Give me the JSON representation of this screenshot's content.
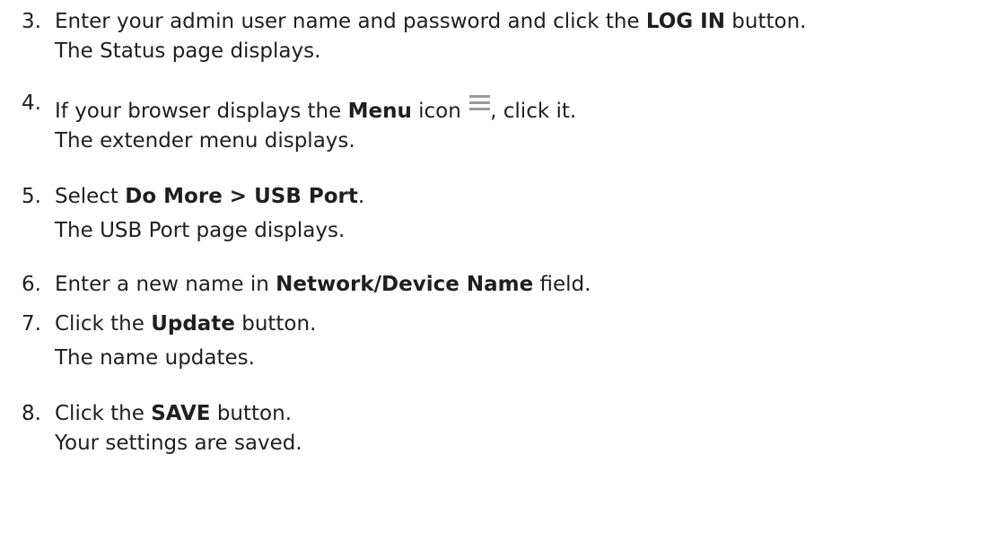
{
  "steps": [
    {
      "number": "3.",
      "lead": "Enter your admin user name and password and click the ",
      "bold": "LOG IN",
      "tail": " button.",
      "result": "The Status page displays."
    },
    {
      "number": "4.",
      "lead": "If your browser displays the ",
      "bold": "Menu",
      "tail_before_icon": " icon ",
      "icon": "hamburger-menu-icon",
      "tail_after_icon": ", click it.",
      "result": "The extender menu displays."
    },
    {
      "number": "5.",
      "lead": "Select ",
      "bold": "Do More > USB Port",
      "tail": ".",
      "result": "The USB Port page displays."
    },
    {
      "number": "6.",
      "lead": "Enter a new name in ",
      "bold": "Network/Device Name",
      "tail": " field."
    },
    {
      "number": "7.",
      "lead": "Click the ",
      "bold": "Update",
      "tail": " button.",
      "result": "The name updates."
    },
    {
      "number": "8.",
      "lead": "Click the ",
      "bold": "SAVE",
      "tail": " button.",
      "result": "Your settings are saved."
    }
  ]
}
